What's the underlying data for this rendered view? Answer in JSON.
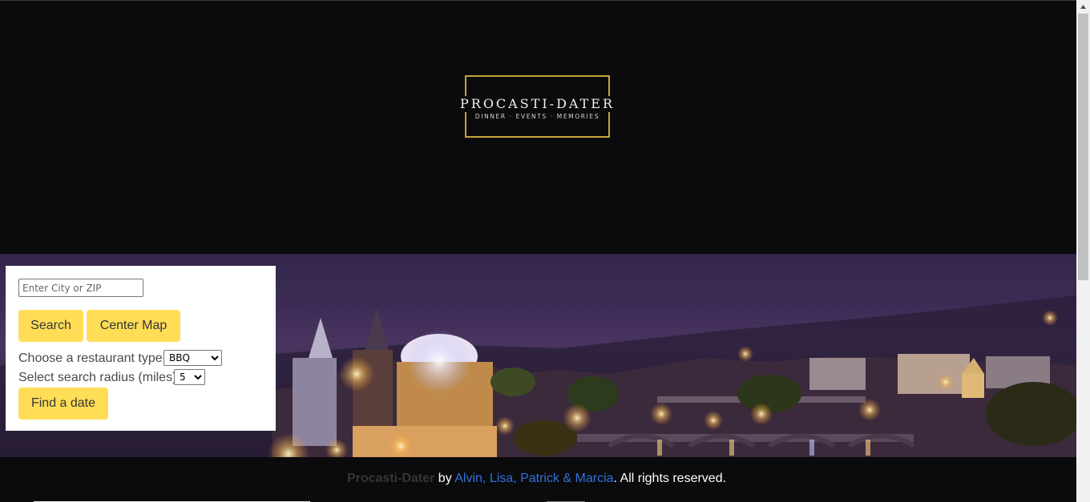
{
  "header": {
    "logo_title": "PROCASTI-DATER",
    "logo_subtitle": "DINNER · EVENTS · MEMORIES"
  },
  "search_panel": {
    "city_placeholder": "Enter City or ZIP",
    "search_label": "Search",
    "center_map_label": "Center Map",
    "restaurant_type_label": "Choose a restaurant type",
    "restaurant_type_value": "BBQ",
    "radius_label": "Select search radius (miles)",
    "radius_value": "5",
    "find_date_label": "Find a date"
  },
  "footer": {
    "brand": "Procasti-Dater",
    "by": " by ",
    "authors": "Alvin, Lisa, Patrick & Marcia",
    "rights": ". All rights reserved."
  },
  "colors": {
    "accent": "#ffdd57",
    "logo_gold": "#c9a43a",
    "link": "#3273dc",
    "background": "#0b0a0c"
  }
}
